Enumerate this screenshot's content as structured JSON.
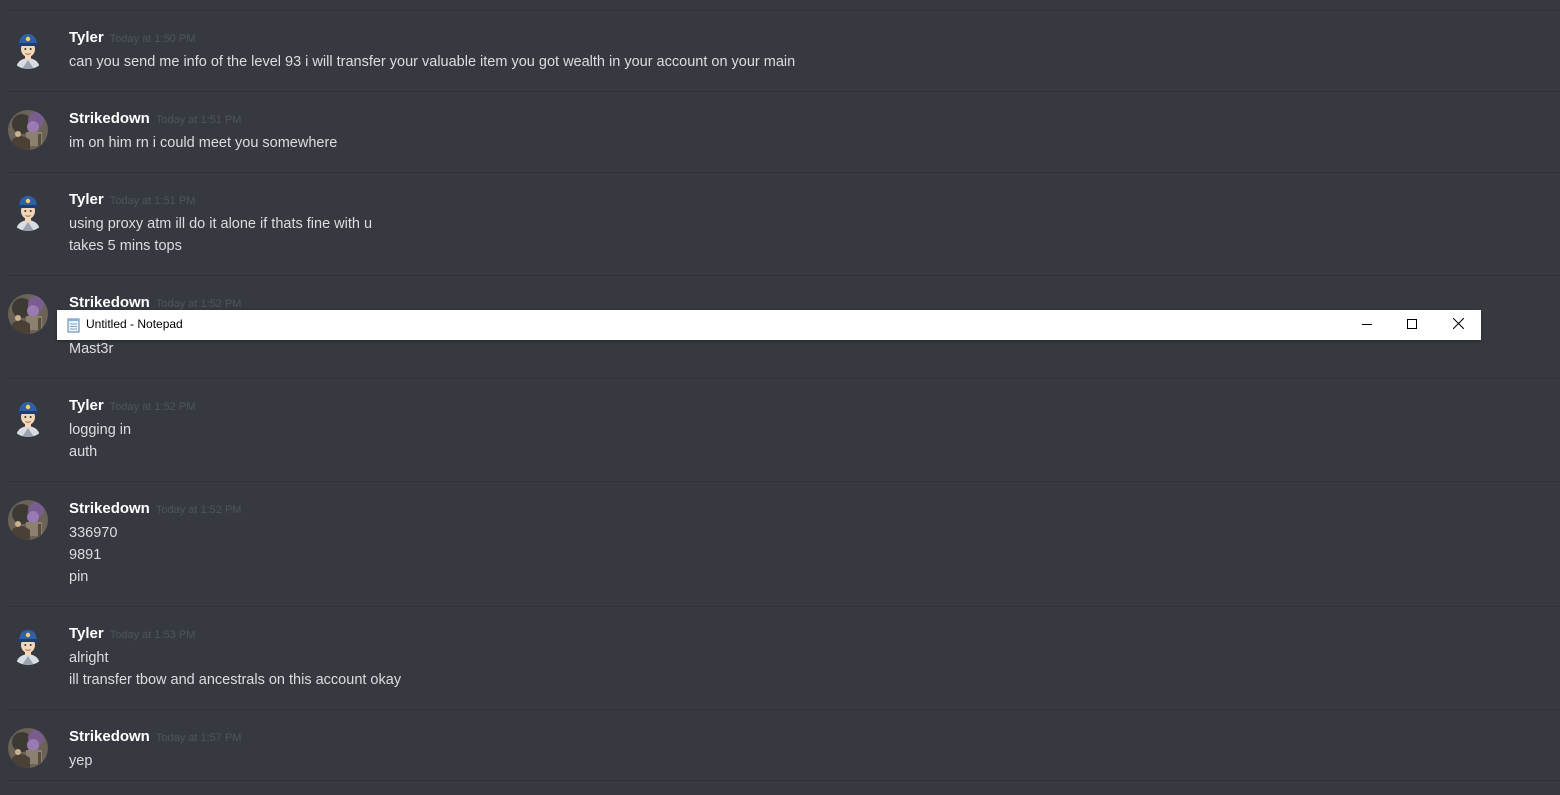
{
  "messages": [
    {
      "author": "Tyler",
      "avatar_icon": "police-avatar-icon",
      "timestamp": "Today at 1:50 PM",
      "lines": [
        "can you send me info of the level 93 i will transfer your valuable item you got wealth in your account on your main"
      ]
    },
    {
      "author": "Strikedown",
      "avatar_icon": "character-avatar-icon",
      "timestamp": "Today at 1:51 PM",
      "lines": [
        "im on him rn i could meet you somewhere"
      ]
    },
    {
      "author": "Tyler",
      "avatar_icon": "police-avatar-icon",
      "timestamp": "Today at 1:51 PM",
      "lines": [
        "using proxy atm ill do it alone if thats fine with u",
        "takes 5 mins tops"
      ]
    },
    {
      "author": "Strikedown",
      "avatar_icon": "character-avatar-icon",
      "timestamp": "Today at 1:52 PM",
      "lines": [
        "",
        "Mast3r"
      ]
    },
    {
      "author": "Tyler",
      "avatar_icon": "police-avatar-icon",
      "timestamp": "Today at 1:52 PM",
      "lines": [
        "logging in",
        "auth"
      ]
    },
    {
      "author": "Strikedown",
      "avatar_icon": "character-avatar-icon",
      "timestamp": "Today at 1:52 PM",
      "lines": [
        "336970",
        "9891",
        "pin"
      ]
    },
    {
      "author": "Tyler",
      "avatar_icon": "police-avatar-icon",
      "timestamp": "Today at 1:53 PM",
      "lines": [
        "alright",
        "ill transfer tbow and ancestrals on this account okay"
      ]
    },
    {
      "author": "Strikedown",
      "avatar_icon": "character-avatar-icon",
      "timestamp": "Today at 1:57 PM",
      "lines": [
        "yep"
      ]
    }
  ],
  "notepad": {
    "title": "Untitled - Notepad",
    "icon": "notepad-icon",
    "buttons": [
      "minimize-icon",
      "maximize-icon",
      "close-icon"
    ]
  },
  "colors": {
    "background": "#36393f",
    "username": "#ffffff",
    "timestamp": "#4f545c",
    "message_text": "#dcddde",
    "divider": "#2f3237"
  }
}
